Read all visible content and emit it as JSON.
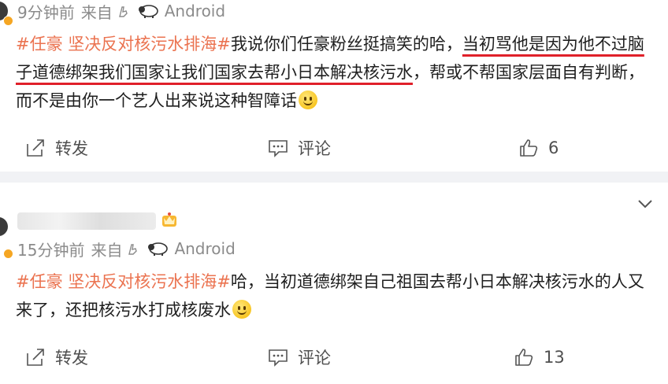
{
  "post1": {
    "time": "9分钟前",
    "source_prefix": "来自",
    "device": "Android",
    "content_hashtag": "#任豪 坚决反对核污水排海#",
    "content_before": "我说你们任豪粉丝挺搞笑的哈，",
    "content_highlight": "当初骂他是因为他不过脑子道德绑架我们国家让我们国家去帮小日本解决核污水",
    "content_after": "，帮或不帮国家层面自有判断，而不是由你一个艺人出来说这种智障话",
    "repost_label": "转发",
    "comment_label": "评论",
    "like_count": "6"
  },
  "post2": {
    "time": "15分钟前",
    "source_prefix": "来自",
    "device": "Android",
    "content_hashtag": "#任豪 坚决反对核污水排海#",
    "content_text": "哈，当初道德绑架自己祖国去帮小日本解决核污水的人又来了，还把核污水打成核废水",
    "repost_label": "转发",
    "comment_label": "评论",
    "like_count": "13"
  },
  "colors": {
    "hashtag": "#eb7350",
    "underline": "#e0202a",
    "meta_text": "#8b8b8b",
    "background": "#f1f2f5"
  },
  "icons": {
    "device": "sheep-icon",
    "source": "hand-icon",
    "repost": "share-icon",
    "comment": "comment-icon",
    "like": "thumbs-up-icon",
    "emoji": "smile-emoji",
    "crown": "crown-badge-icon",
    "more": "chevron-down-icon"
  }
}
